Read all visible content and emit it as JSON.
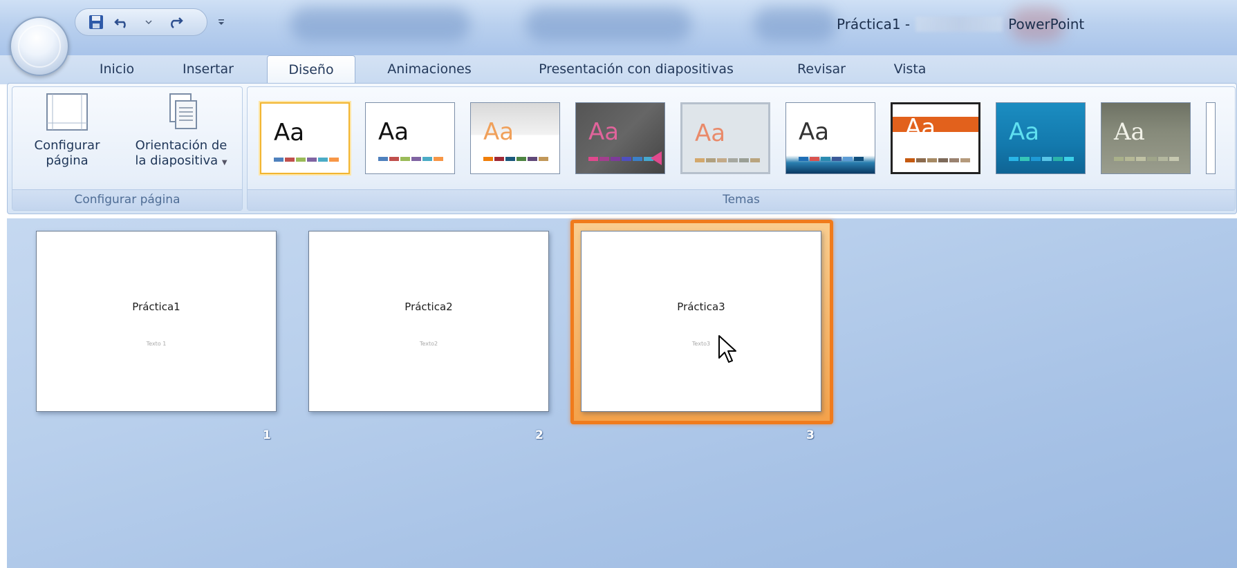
{
  "window": {
    "title": "Práctica1 -",
    "app": "PowerPoint"
  },
  "quick_access": {
    "icons": [
      "save-icon",
      "undo-icon",
      "undo-dropdown-icon",
      "redo-icon",
      "customize-dropdown-icon"
    ]
  },
  "tabs": [
    {
      "label": "Inicio",
      "active": false
    },
    {
      "label": "Insertar",
      "active": false
    },
    {
      "label": "Diseño",
      "active": true
    },
    {
      "label": "Animaciones",
      "active": false
    },
    {
      "label": "Presentación con diapositivas",
      "active": false
    },
    {
      "label": "Revisar",
      "active": false
    },
    {
      "label": "Vista",
      "active": false
    }
  ],
  "ribbon": {
    "page_setup_group": {
      "label": "Configurar página",
      "page_setup_button": {
        "line1": "Configurar",
        "line2": "página"
      },
      "orientation_button": {
        "line1": "Orientación de",
        "line2": "la diapositiva"
      }
    },
    "themes_group": {
      "label": "Temas",
      "themes": [
        {
          "sample": "Aa",
          "selected": true
        },
        {
          "sample": "Aa",
          "selected": false
        },
        {
          "sample": "Aa",
          "selected": false
        },
        {
          "sample": "Aa",
          "selected": false
        },
        {
          "sample": "Aa",
          "selected": false
        },
        {
          "sample": "Aa",
          "selected": false
        },
        {
          "sample": "Aa",
          "selected": false
        },
        {
          "sample": "Aa",
          "selected": false
        },
        {
          "sample": "Aa",
          "selected": false
        }
      ]
    }
  },
  "slides": [
    {
      "title": "Práctica1",
      "subtitle": "Texto 1",
      "number": "1",
      "selected": false
    },
    {
      "title": "Práctica2",
      "subtitle": "Texto2",
      "number": "2",
      "selected": false
    },
    {
      "title": "Práctica3",
      "subtitle": "Texto3",
      "number": "3",
      "selected": true
    }
  ],
  "colors": {
    "accent_selection": "#f07b1c",
    "theme_selected_border": "#f2b531",
    "sorter_background": "#a7c2e6"
  }
}
